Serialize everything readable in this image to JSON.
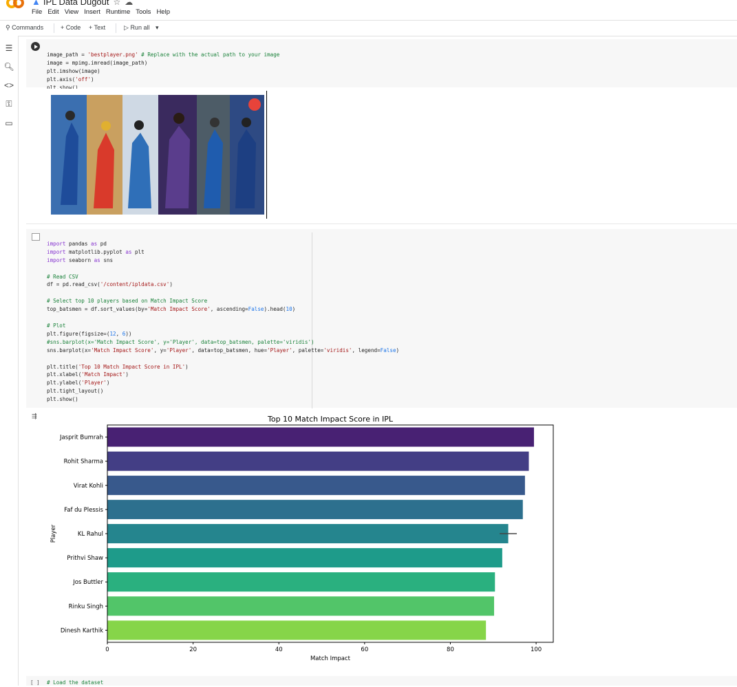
{
  "header": {
    "title": "IPL Data Dugout",
    "menus": [
      "File",
      "Edit",
      "View",
      "Insert",
      "Runtime",
      "Tools",
      "Help"
    ]
  },
  "toolbar": {
    "commands": "Commands",
    "code": "+ Code",
    "text": "+ Text",
    "run_all": "Run all"
  },
  "cell1": {
    "lines": [
      "image_path = 'bestplayer.png' # Replace with the actual path to your image",
      "image = mpimg.imread(image_path)",
      "plt.imshow(image)",
      "plt.axis('off')",
      "plt.show()"
    ]
  },
  "cell2": {
    "lines": [
      "import pandas as pd",
      "import matplotlib.pyplot as plt",
      "import seaborn as sns",
      "",
      "# Read CSV",
      "df = pd.read_csv('/content/ipldata.csv')",
      "",
      "# Select top 10 players based on Match Impact Score",
      "top_batsmen = df.sort_values(by='Match Impact Score', ascending=False).head(10)",
      "",
      "# Plot",
      "plt.figure(figsize=(12, 6))",
      "#sns.barplot(x='Match Impact Score', y='Player', data=top_batsmen, palette='viridis')",
      "sns.barplot(x='Match Impact Score', y='Player', data=top_batsmen, hue='Player', palette='viridis', legend=False)",
      "",
      "plt.title('Top 10 Match Impact Score in IPL')",
      "plt.xlabel('Match Impact')",
      "plt.ylabel('Player')",
      "plt.tight_layout()",
      "plt.show()"
    ]
  },
  "cell3": {
    "prompt": "[ ]",
    "line": "# Load the dataset"
  },
  "chart_data": {
    "type": "bar",
    "orientation": "horizontal",
    "title": "Top 10 Match Impact Score in IPL",
    "xlabel": "Match Impact",
    "ylabel": "Player",
    "categories": [
      "Jasprit Bumrah",
      "Rohit Sharma",
      "Virat Kohli",
      "Faf du Plessis",
      "KL Rahul",
      "Prithvi Shaw",
      "Jos Buttler",
      "Rinku Singh",
      "Dinesh Karthik"
    ],
    "values": [
      99.5,
      98.3,
      97.4,
      96.9,
      93.5,
      92.1,
      90.4,
      90.2,
      88.3
    ],
    "error_bars": [
      null,
      null,
      null,
      null,
      [
        91.5,
        95.5
      ],
      null,
      null,
      null,
      null
    ],
    "xlim": [
      0,
      104
    ],
    "xticks": [
      0,
      20,
      40,
      60,
      80,
      100
    ],
    "colors": [
      "#482173",
      "#433e85",
      "#38598c",
      "#2d708e",
      "#25858e",
      "#1e9b8a",
      "#2ab07f",
      "#52c569",
      "#86d549",
      "#c2df23"
    ],
    "grid": false
  }
}
